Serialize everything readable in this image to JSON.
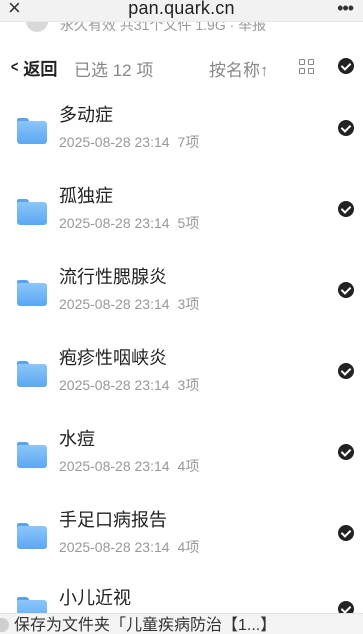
{
  "browser": {
    "url": "pan.quark.cn",
    "close_glyph": "×",
    "more_glyph": "•••"
  },
  "share_info": {
    "text": "永久有效 共31个文件 1.9G · 举报"
  },
  "toolbar": {
    "back_label": "返回",
    "selected_label": "已选 12 项",
    "sort_label": "按名称↑"
  },
  "files": [
    {
      "name": "多动症",
      "date": "2025-08-28 23:14",
      "count": "7项",
      "selected": true
    },
    {
      "name": "孤独症",
      "date": "2025-08-28 23:14",
      "count": "5项",
      "selected": true
    },
    {
      "name": "流行性腮腺炎",
      "date": "2025-08-28 23:14",
      "count": "3项",
      "selected": true
    },
    {
      "name": "疱疹性咽峡炎",
      "date": "2025-08-28 23:14",
      "count": "3项",
      "selected": true
    },
    {
      "name": "水痘",
      "date": "2025-08-28 23:14",
      "count": "4项",
      "selected": true
    },
    {
      "name": "手足口病报告",
      "date": "2025-08-28 23:14",
      "count": "4项",
      "selected": true
    },
    {
      "name": "小儿近视",
      "date": "",
      "count": "",
      "selected": true
    }
  ],
  "bottom": {
    "save_text": "保存为文件夹「儿童疾病防治【1...】"
  },
  "colors": {
    "folder": "#5ba7f2",
    "check": "#222222",
    "muted": "#999999"
  }
}
